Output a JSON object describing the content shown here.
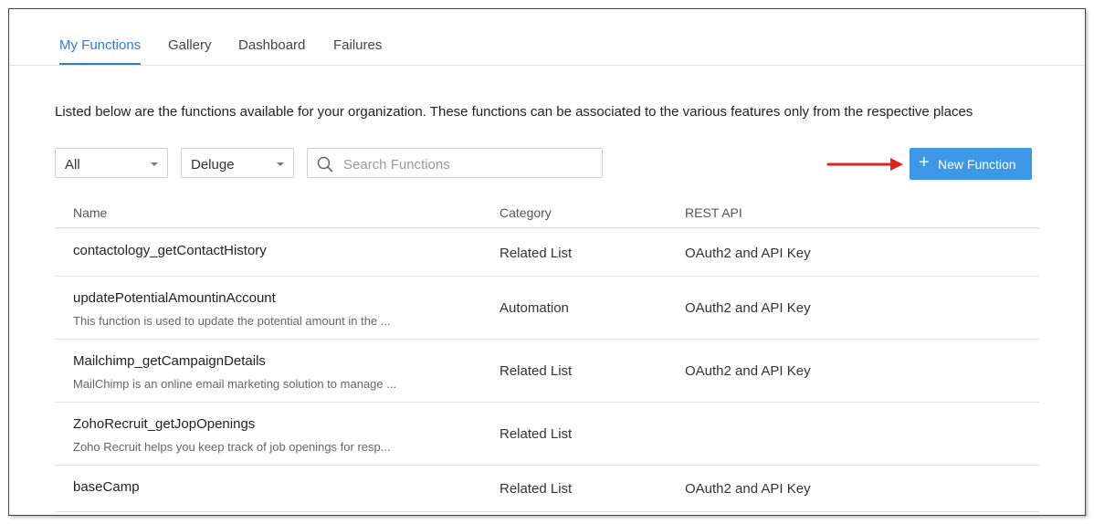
{
  "tabs": [
    {
      "label": "My Functions",
      "active": true
    },
    {
      "label": "Gallery",
      "active": false
    },
    {
      "label": "Dashboard",
      "active": false
    },
    {
      "label": "Failures",
      "active": false
    }
  ],
  "description": "Listed below are the functions available for your organization. These functions can be associated to the various features only from the respective places",
  "filters": {
    "category_selected": "All",
    "language_selected": "Deluge"
  },
  "search": {
    "placeholder": "Search Functions",
    "value": ""
  },
  "new_function_button": {
    "label": "New Function",
    "color": "#3d99e8"
  },
  "annotation": {
    "arrow_color": "#e0241c"
  },
  "table": {
    "headers": {
      "name": "Name",
      "category": "Category",
      "rest_api": "REST API"
    },
    "rows": [
      {
        "name": "contactology_getContactHistory",
        "description": "",
        "category": "Related List",
        "rest_api": "OAuth2 and API Key"
      },
      {
        "name": "updatePotentialAmountinAccount",
        "description": "This function is used to update the potential amount in the ...",
        "category": "Automation",
        "rest_api": "OAuth2 and API Key"
      },
      {
        "name": "Mailchimp_getCampaignDetails",
        "description": "MailChimp is an online email marketing solution to manage ...",
        "category": "Related List",
        "rest_api": "OAuth2 and API Key"
      },
      {
        "name": "ZohoRecruit_getJopOpenings",
        "description": "Zoho Recruit helps you keep track of job openings for resp...",
        "category": "Related List",
        "rest_api": ""
      },
      {
        "name": "baseCamp",
        "description": "",
        "category": "Related List",
        "rest_api": "OAuth2 and API Key"
      }
    ]
  },
  "accent_color": "#2f7bd4"
}
